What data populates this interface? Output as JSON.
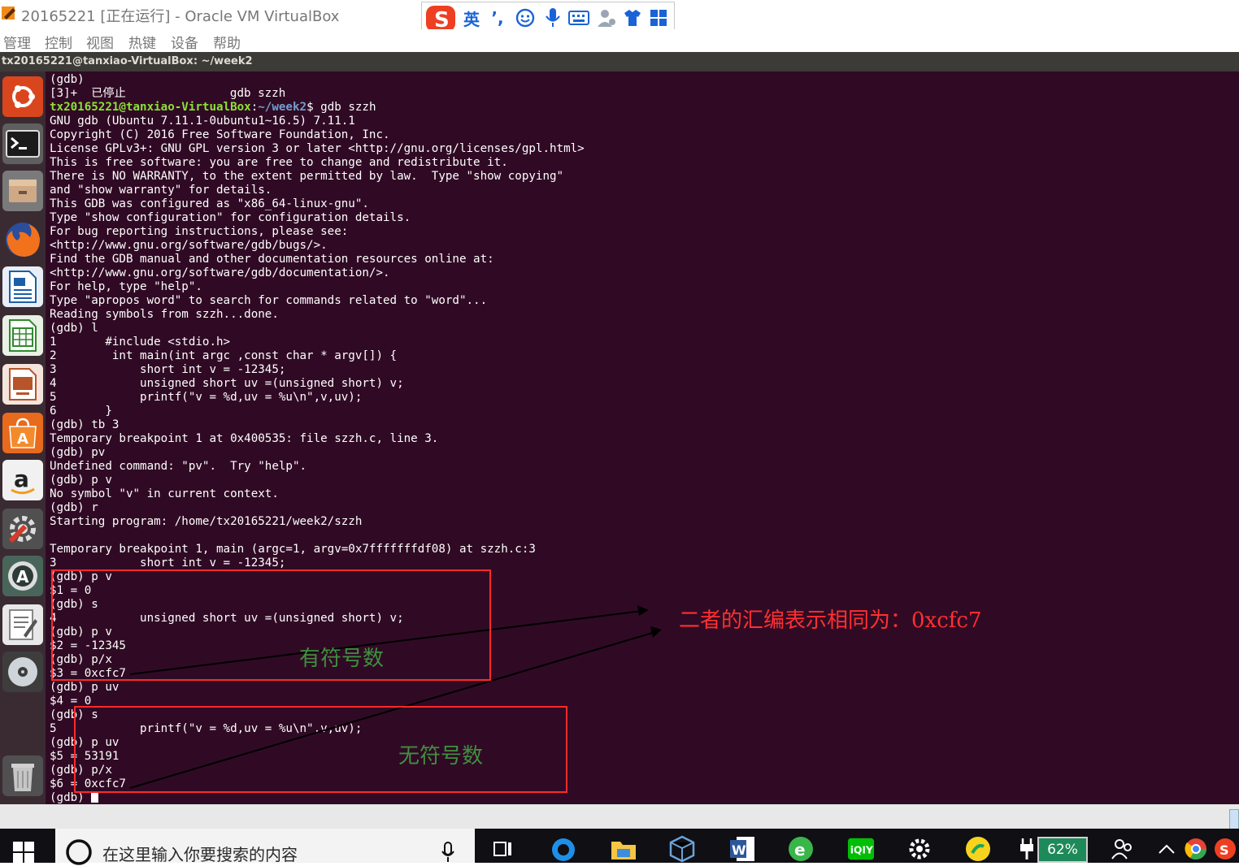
{
  "window": {
    "title": "20165221 [正在运行] - Oracle VM VirtualBox",
    "menu": [
      "管理",
      "控制",
      "视图",
      "热键",
      "设备",
      "帮助"
    ]
  },
  "ime_toolbar": {
    "logo": "S",
    "lang": "英",
    "punct": "’,",
    "icons": [
      "smiley-icon",
      "microphone-icon",
      "keyboard-icon",
      "user-icon",
      "shirt-icon",
      "grid-icon"
    ]
  },
  "ubuntu": {
    "window_title": "tx20165221@tanxiao-VirtualBox: ~/week2",
    "launcher": [
      "ubuntu-dash-icon",
      "terminal-icon",
      "files-icon",
      "firefox-icon",
      "writer-icon",
      "calc-icon",
      "impress-icon",
      "software-center-icon",
      "amazon-icon",
      "settings-icon",
      "updater-icon",
      "text-editor-icon",
      "dvd-icon",
      "trash-icon"
    ]
  },
  "terminal": {
    "prompt": {
      "user": "tx20165221@tanxiao-VirtualBox",
      "colon": ":",
      "path": "~/week2",
      "sym": "$ ",
      "cmd": "gdb szzh"
    },
    "lines_before": [
      "(gdb)",
      "[3]+  已停止               gdb szzh"
    ],
    "lines_after": [
      "GNU gdb (Ubuntu 7.11.1-0ubuntu1~16.5) 7.11.1",
      "Copyright (C) 2016 Free Software Foundation, Inc.",
      "License GPLv3+: GNU GPL version 3 or later <http://gnu.org/licenses/gpl.html>",
      "This is free software: you are free to change and redistribute it.",
      "There is NO WARRANTY, to the extent permitted by law.  Type \"show copying\"",
      "and \"show warranty\" for details.",
      "This GDB was configured as \"x86_64-linux-gnu\".",
      "Type \"show configuration\" for configuration details.",
      "For bug reporting instructions, please see:",
      "<http://www.gnu.org/software/gdb/bugs/>.",
      "Find the GDB manual and other documentation resources online at:",
      "<http://www.gnu.org/software/gdb/documentation/>.",
      "For help, type \"help\".",
      "Type \"apropos word\" to search for commands related to \"word\"...",
      "Reading symbols from szzh...done.",
      "(gdb) l",
      "1       #include <stdio.h>",
      "2        int main(int argc ,const char * argv[]) {",
      "3            short int v = -12345;",
      "4            unsigned short uv =(unsigned short) v;",
      "5            printf(\"v = %d,uv = %u\\n\",v,uv);",
      "6       }",
      "(gdb) tb 3",
      "Temporary breakpoint 1 at 0x400535: file szzh.c, line 3.",
      "(gdb) pv",
      "Undefined command: \"pv\".  Try \"help\".",
      "(gdb) p v",
      "No symbol \"v\" in current context.",
      "(gdb) r",
      "Starting program: /home/tx20165221/week2/szzh",
      "",
      "Temporary breakpoint 1, main (argc=1, argv=0x7fffffffdf08) at szzh.c:3",
      "3            short int v = -12345;",
      "(gdb) p v",
      "$1 = 0",
      "(gdb) s",
      "4            unsigned short uv =(unsigned short) v;",
      "(gdb) p v",
      "$2 = -12345",
      "(gdb) p/x",
      "$3 = 0xcfc7",
      "(gdb) p uv",
      "$4 = 0",
      "(gdb) s",
      "5            printf(\"v = %d,uv = %u\\n\",v,uv);",
      "(gdb) p uv",
      "$5 = 53191",
      "(gdb) p/x",
      "$6 = 0xcfc7"
    ],
    "last_prompt": "(gdb) "
  },
  "annotations": {
    "signed_label": "有符号数",
    "unsigned_label": "无符号数",
    "conclusion": "二者的汇编表示相同为：0xcfc7",
    "colors": {
      "box": "#ff2a2a",
      "label": "#3f8f3f",
      "conclusion": "#ff3030"
    }
  },
  "taskbar": {
    "search_placeholder": "在这里输入你要搜索的内容",
    "battery": "62%",
    "apps": [
      "cortana-icon",
      "task-view-icon",
      "qq-browser-icon",
      "file-explorer-icon",
      "virtualbox-icon",
      "word-icon",
      "browser-e-icon",
      "iqiyi-icon",
      "settings-icon",
      "qq-music-icon"
    ]
  }
}
